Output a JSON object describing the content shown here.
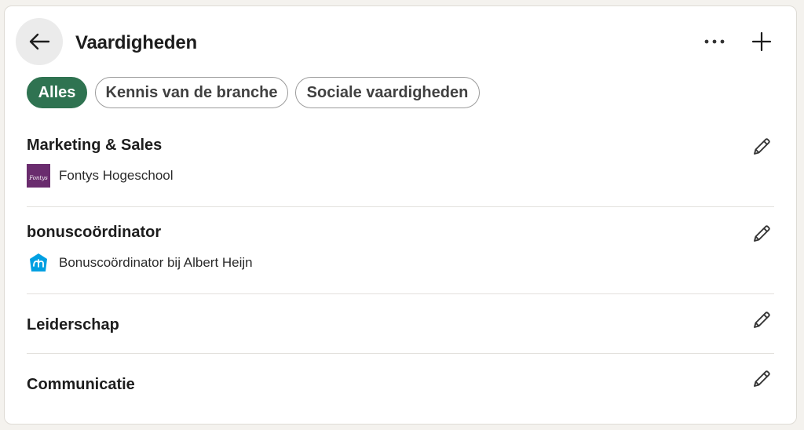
{
  "header": {
    "title": "Vaardigheden",
    "back_icon": "arrow-left-icon",
    "more_icon": "ellipsis-icon",
    "add_icon": "plus-icon"
  },
  "filters": [
    {
      "label": "Alles",
      "active": true
    },
    {
      "label": "Kennis van de branche",
      "active": false
    },
    {
      "label": "Sociale vaardigheden",
      "active": false
    }
  ],
  "skills": [
    {
      "name": "Marketing & Sales",
      "source": "Fontys Hogeschool",
      "source_logo": "fontys-logo",
      "logo_text": "Fontys"
    },
    {
      "name": "bonuscoördinator",
      "source": "Bonuscoördinator bij Albert Heijn",
      "source_logo": "albert-heijn-logo",
      "logo_text": ""
    },
    {
      "name": "Leiderschap"
    },
    {
      "name": "Communicatie"
    }
  ],
  "colors": {
    "accent": "#2f7351",
    "fontys": "#6a2c6e",
    "albert_heijn": "#00a0e2"
  }
}
